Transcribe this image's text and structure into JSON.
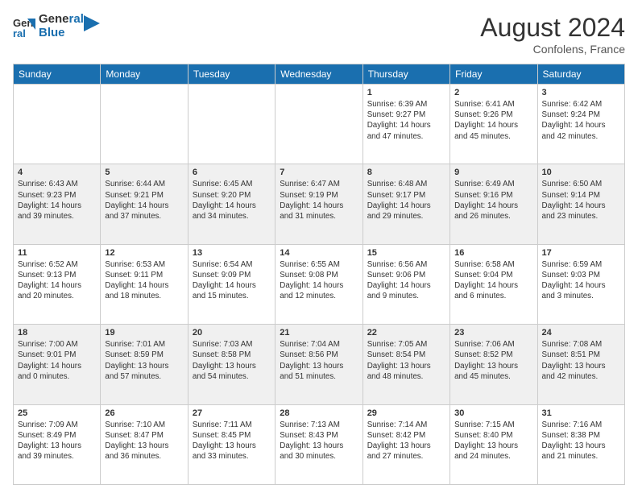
{
  "header": {
    "logo": {
      "line1": "General",
      "line2": "Blue"
    },
    "title": "August 2024",
    "location": "Confolens, France"
  },
  "weekdays": [
    "Sunday",
    "Monday",
    "Tuesday",
    "Wednesday",
    "Thursday",
    "Friday",
    "Saturday"
  ],
  "weeks": [
    [
      {
        "day": "",
        "info": ""
      },
      {
        "day": "",
        "info": ""
      },
      {
        "day": "",
        "info": ""
      },
      {
        "day": "",
        "info": ""
      },
      {
        "day": "1",
        "info": "Sunrise: 6:39 AM\nSunset: 9:27 PM\nDaylight: 14 hours\nand 47 minutes."
      },
      {
        "day": "2",
        "info": "Sunrise: 6:41 AM\nSunset: 9:26 PM\nDaylight: 14 hours\nand 45 minutes."
      },
      {
        "day": "3",
        "info": "Sunrise: 6:42 AM\nSunset: 9:24 PM\nDaylight: 14 hours\nand 42 minutes."
      }
    ],
    [
      {
        "day": "4",
        "info": "Sunrise: 6:43 AM\nSunset: 9:23 PM\nDaylight: 14 hours\nand 39 minutes."
      },
      {
        "day": "5",
        "info": "Sunrise: 6:44 AM\nSunset: 9:21 PM\nDaylight: 14 hours\nand 37 minutes."
      },
      {
        "day": "6",
        "info": "Sunrise: 6:45 AM\nSunset: 9:20 PM\nDaylight: 14 hours\nand 34 minutes."
      },
      {
        "day": "7",
        "info": "Sunrise: 6:47 AM\nSunset: 9:19 PM\nDaylight: 14 hours\nand 31 minutes."
      },
      {
        "day": "8",
        "info": "Sunrise: 6:48 AM\nSunset: 9:17 PM\nDaylight: 14 hours\nand 29 minutes."
      },
      {
        "day": "9",
        "info": "Sunrise: 6:49 AM\nSunset: 9:16 PM\nDaylight: 14 hours\nand 26 minutes."
      },
      {
        "day": "10",
        "info": "Sunrise: 6:50 AM\nSunset: 9:14 PM\nDaylight: 14 hours\nand 23 minutes."
      }
    ],
    [
      {
        "day": "11",
        "info": "Sunrise: 6:52 AM\nSunset: 9:13 PM\nDaylight: 14 hours\nand 20 minutes."
      },
      {
        "day": "12",
        "info": "Sunrise: 6:53 AM\nSunset: 9:11 PM\nDaylight: 14 hours\nand 18 minutes."
      },
      {
        "day": "13",
        "info": "Sunrise: 6:54 AM\nSunset: 9:09 PM\nDaylight: 14 hours\nand 15 minutes."
      },
      {
        "day": "14",
        "info": "Sunrise: 6:55 AM\nSunset: 9:08 PM\nDaylight: 14 hours\nand 12 minutes."
      },
      {
        "day": "15",
        "info": "Sunrise: 6:56 AM\nSunset: 9:06 PM\nDaylight: 14 hours\nand 9 minutes."
      },
      {
        "day": "16",
        "info": "Sunrise: 6:58 AM\nSunset: 9:04 PM\nDaylight: 14 hours\nand 6 minutes."
      },
      {
        "day": "17",
        "info": "Sunrise: 6:59 AM\nSunset: 9:03 PM\nDaylight: 14 hours\nand 3 minutes."
      }
    ],
    [
      {
        "day": "18",
        "info": "Sunrise: 7:00 AM\nSunset: 9:01 PM\nDaylight: 14 hours\nand 0 minutes."
      },
      {
        "day": "19",
        "info": "Sunrise: 7:01 AM\nSunset: 8:59 PM\nDaylight: 13 hours\nand 57 minutes."
      },
      {
        "day": "20",
        "info": "Sunrise: 7:03 AM\nSunset: 8:58 PM\nDaylight: 13 hours\nand 54 minutes."
      },
      {
        "day": "21",
        "info": "Sunrise: 7:04 AM\nSunset: 8:56 PM\nDaylight: 13 hours\nand 51 minutes."
      },
      {
        "day": "22",
        "info": "Sunrise: 7:05 AM\nSunset: 8:54 PM\nDaylight: 13 hours\nand 48 minutes."
      },
      {
        "day": "23",
        "info": "Sunrise: 7:06 AM\nSunset: 8:52 PM\nDaylight: 13 hours\nand 45 minutes."
      },
      {
        "day": "24",
        "info": "Sunrise: 7:08 AM\nSunset: 8:51 PM\nDaylight: 13 hours\nand 42 minutes."
      }
    ],
    [
      {
        "day": "25",
        "info": "Sunrise: 7:09 AM\nSunset: 8:49 PM\nDaylight: 13 hours\nand 39 minutes."
      },
      {
        "day": "26",
        "info": "Sunrise: 7:10 AM\nSunset: 8:47 PM\nDaylight: 13 hours\nand 36 minutes."
      },
      {
        "day": "27",
        "info": "Sunrise: 7:11 AM\nSunset: 8:45 PM\nDaylight: 13 hours\nand 33 minutes."
      },
      {
        "day": "28",
        "info": "Sunrise: 7:13 AM\nSunset: 8:43 PM\nDaylight: 13 hours\nand 30 minutes."
      },
      {
        "day": "29",
        "info": "Sunrise: 7:14 AM\nSunset: 8:42 PM\nDaylight: 13 hours\nand 27 minutes."
      },
      {
        "day": "30",
        "info": "Sunrise: 7:15 AM\nSunset: 8:40 PM\nDaylight: 13 hours\nand 24 minutes."
      },
      {
        "day": "31",
        "info": "Sunrise: 7:16 AM\nSunset: 8:38 PM\nDaylight: 13 hours\nand 21 minutes."
      }
    ]
  ]
}
